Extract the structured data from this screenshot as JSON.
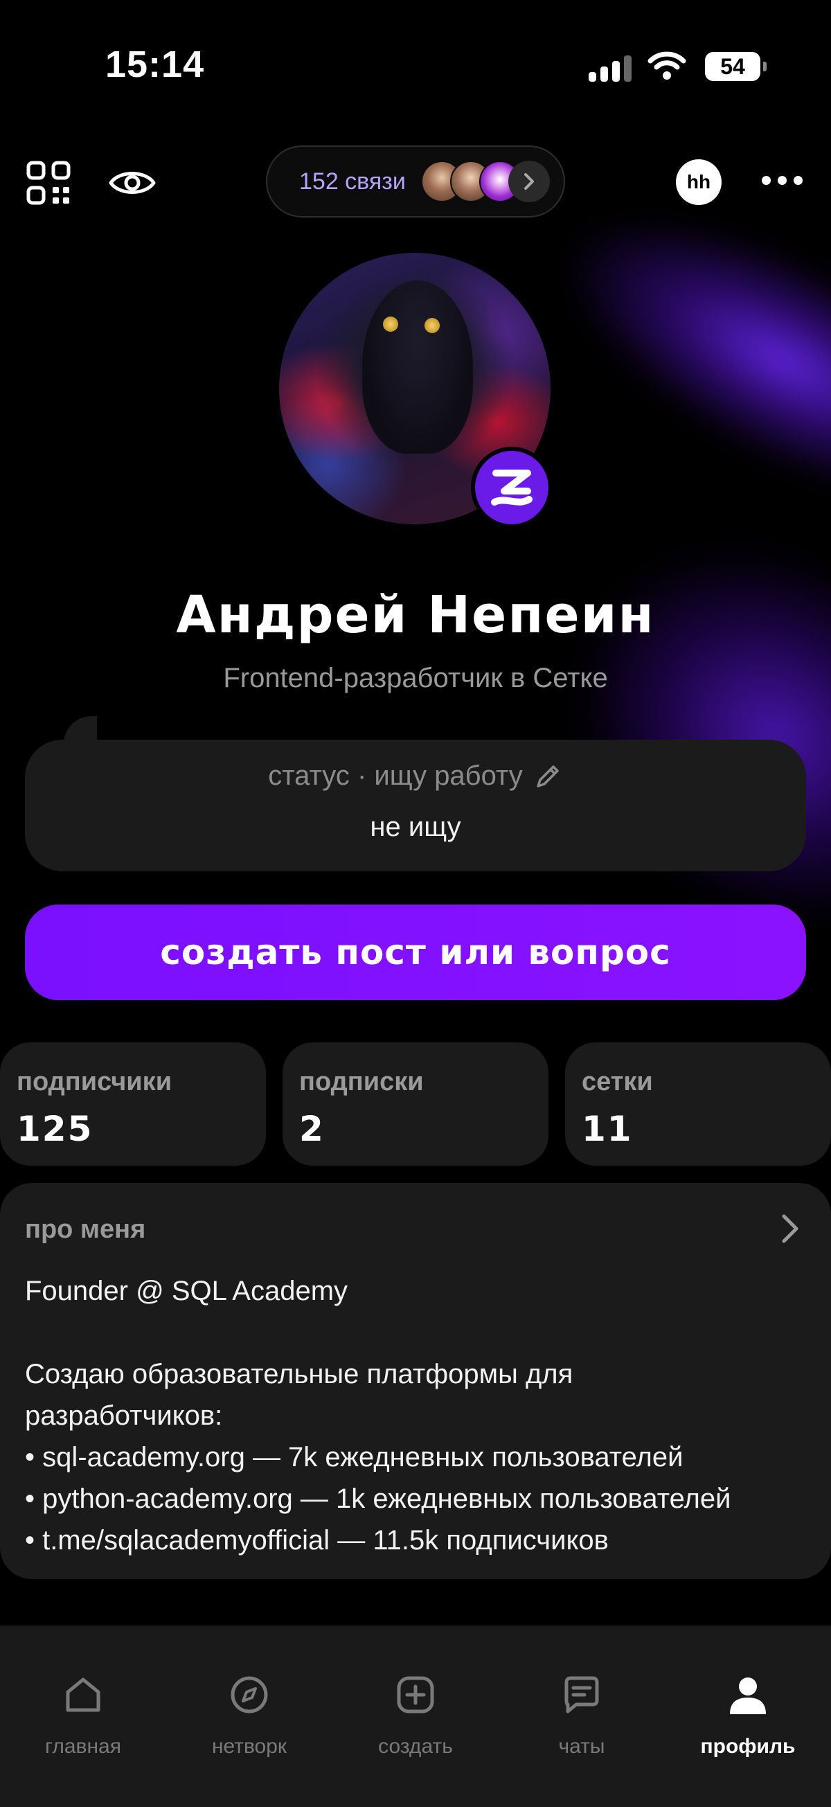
{
  "status_bar": {
    "time": "15:14",
    "battery": "54"
  },
  "toolbar": {
    "connections_label": "152 связи",
    "hh_label": "hh"
  },
  "profile": {
    "name": "Андрей Непеин",
    "subtitle": "Frontend-разработчик в Сетке"
  },
  "status_card": {
    "label": "статус · ищу работу",
    "value": "не ищу"
  },
  "create_button_label": "создать пост или вопрос",
  "stats": [
    {
      "label": "подписчики",
      "value": "125"
    },
    {
      "label": "подписки",
      "value": "2"
    },
    {
      "label": "сетки",
      "value": "11"
    }
  ],
  "about": {
    "label": "про меня",
    "lines": [
      "Founder @ SQL Academy",
      "Создаю образовательные платформы для",
      "разработчиков:",
      "• sql-academy.org — 7k ежедневных пользователей",
      "• python-academy.org — 1k ежедневных пользователей",
      "• t.me/sqlacademyofficial — 11.5k подписчиков"
    ]
  },
  "nav": [
    {
      "label": "главная",
      "icon": "home-icon"
    },
    {
      "label": "нетворк",
      "icon": "compass-icon"
    },
    {
      "label": "создать",
      "icon": "plus-square-icon"
    },
    {
      "label": "чаты",
      "icon": "chat-icon"
    },
    {
      "label": "профиль",
      "icon": "profile-icon"
    }
  ],
  "colors": {
    "accent": "#7a10ff",
    "card": "#1b1b1b",
    "background": "#000000"
  }
}
